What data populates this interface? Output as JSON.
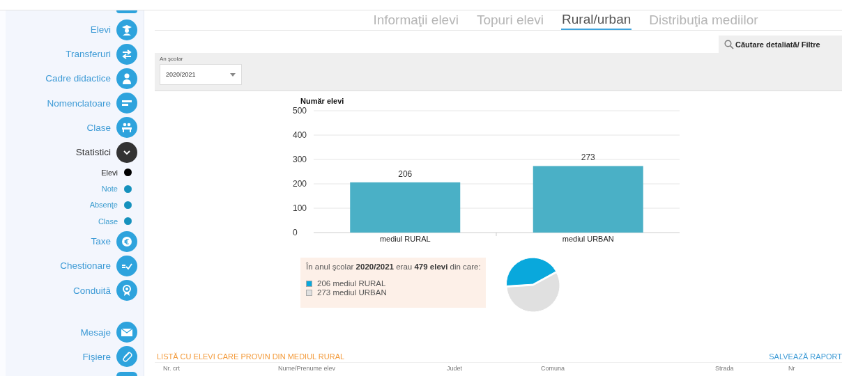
{
  "sidebar": {
    "items": [
      {
        "label": "Elevi",
        "kind": "item",
        "expanded": false
      },
      {
        "label": "Transferuri",
        "kind": "item",
        "expanded": false
      },
      {
        "label": "Cadre didactice",
        "kind": "item",
        "expanded": false
      },
      {
        "label": "Nomenclatoare",
        "kind": "item",
        "expanded": false
      },
      {
        "label": "Clase",
        "kind": "item",
        "expanded": false
      },
      {
        "label": "Statistici",
        "kind": "item",
        "expanded": true
      },
      {
        "label": "Elevi",
        "kind": "sub",
        "selected": true
      },
      {
        "label": "Note",
        "kind": "sub",
        "selected": false
      },
      {
        "label": "Absenţe",
        "kind": "sub",
        "selected": false
      },
      {
        "label": "Clase",
        "kind": "sub",
        "selected": false
      },
      {
        "label": "Taxe",
        "kind": "item",
        "expanded": false
      },
      {
        "label": "Chestionare",
        "kind": "item",
        "expanded": false
      },
      {
        "label": "Conduită",
        "kind": "item",
        "expanded": false
      }
    ],
    "bottom_items": [
      {
        "label": "Mesaje"
      },
      {
        "label": "Fişiere"
      }
    ]
  },
  "tabs": [
    {
      "label": "Informaţii elevi",
      "selected": false
    },
    {
      "label": "Topuri elevi",
      "selected": false
    },
    {
      "label": "Rural/urban",
      "selected": true
    },
    {
      "label": "Distribuţia mediilor",
      "selected": false
    }
  ],
  "search_button": "Căutare detaliată/ Filtre",
  "filter": {
    "label": "An şcolar",
    "value": "2020/2021"
  },
  "chart": {
    "chart_data": {
      "type": "bar",
      "title": "Număr elevi",
      "categories": [
        "mediul RURAL",
        "mediul URBAN"
      ],
      "series": [
        {
          "color": "#4ab0c6",
          "values": [
            206,
            273
          ]
        }
      ],
      "ylim": [
        0,
        500
      ],
      "yticks": [
        0,
        100,
        200,
        300,
        400,
        500
      ],
      "grid": true,
      "data_labels": true
    }
  },
  "summary": {
    "text": "În anul şcolar **2020/2021** erau **479 elevi** din care:",
    "legend": [
      {
        "label": "206 mediul RURAL",
        "color": "#09a8dc"
      },
      {
        "label": "273 mediul URBAN",
        "color": "#e0e0e0"
      }
    ]
  },
  "pie": {
    "chart_data": {
      "type": "pie",
      "values": [
        43,
        57
      ],
      "colors": [
        "#09a8dc",
        "#e0e0e0"
      ]
    }
  },
  "list": {
    "title": "LISTĂ CU ELEVI CARE PROVIN DIN MEDIUL RURAL",
    "save_link": "SALVEAZĂ RAPORT",
    "columns": [
      "Nr. crt",
      "Nume/Prenume elev",
      "Judet",
      "Comuna",
      "Strada",
      "Nr"
    ]
  }
}
